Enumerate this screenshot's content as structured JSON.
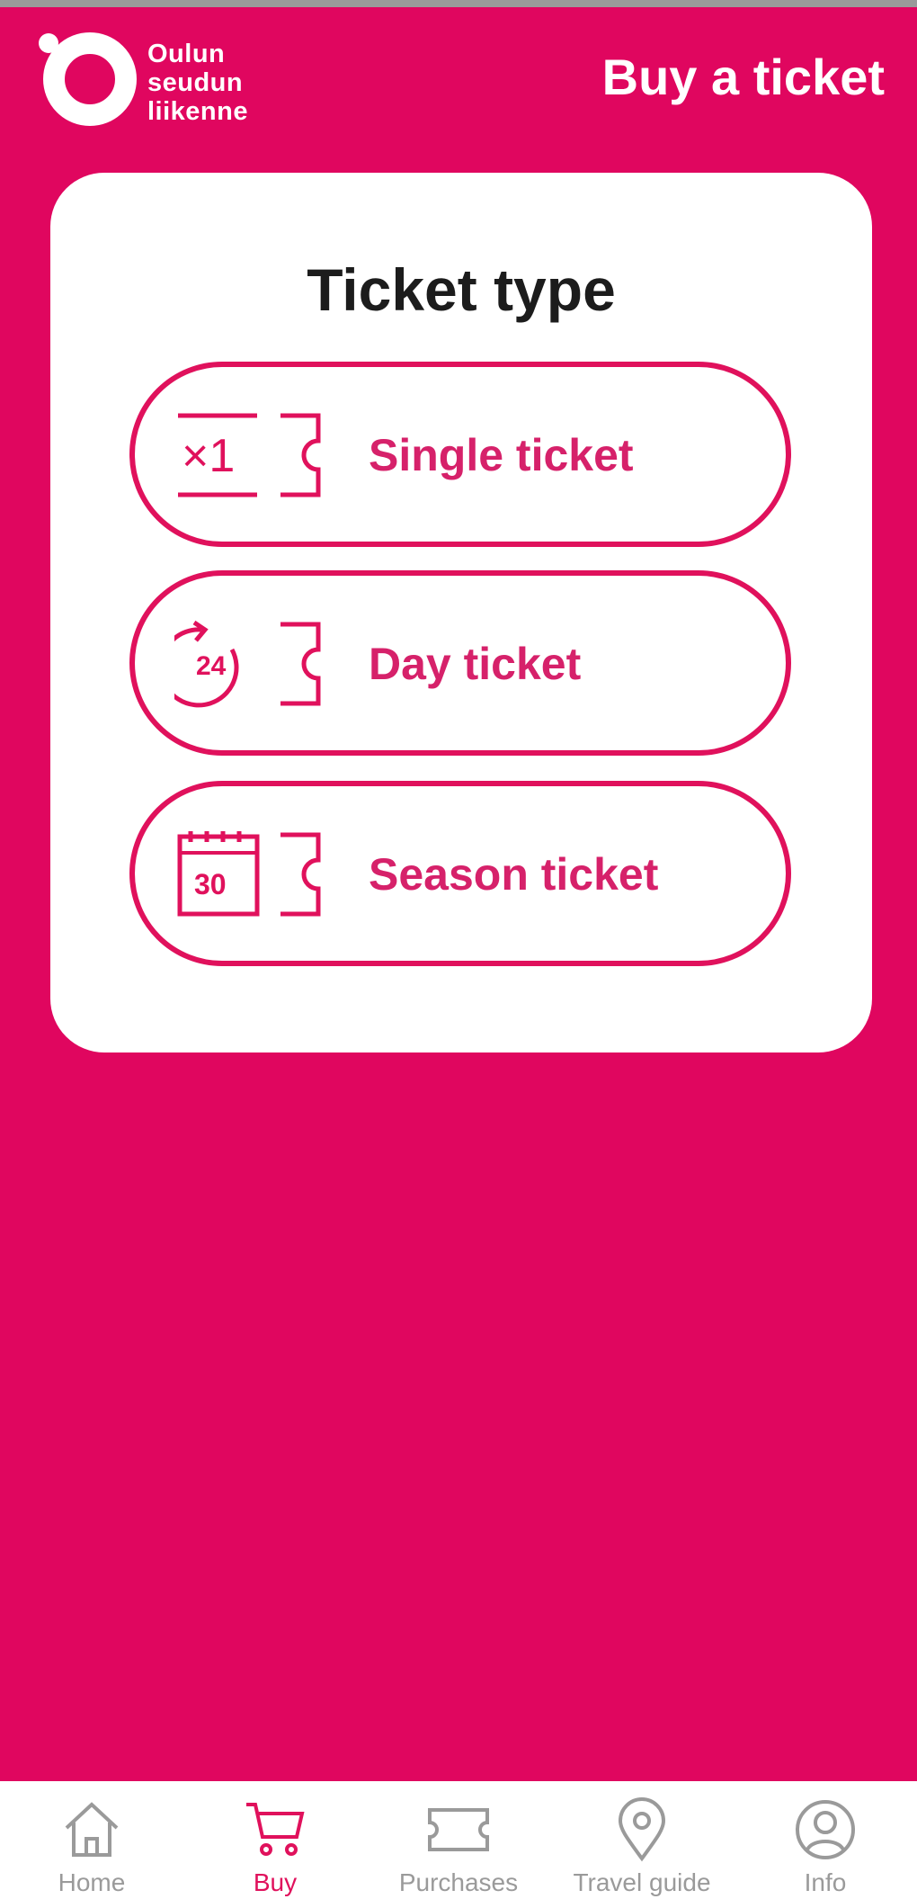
{
  "header": {
    "logo_lines": [
      "Oulun",
      "seudun",
      "liikenne"
    ],
    "title": "Buy a ticket"
  },
  "card": {
    "title": "Ticket type",
    "options": [
      {
        "label": "Single ticket",
        "icon": "single-ticket-icon",
        "icon_text": "×1"
      },
      {
        "label": "Day ticket",
        "icon": "day-ticket-icon",
        "icon_text": "24"
      },
      {
        "label": "Season ticket",
        "icon": "season-ticket-icon",
        "icon_text": "30"
      }
    ]
  },
  "nav": {
    "items": [
      {
        "label": "Home",
        "icon": "home-icon",
        "active": false
      },
      {
        "label": "Buy",
        "icon": "cart-icon",
        "active": true
      },
      {
        "label": "Purchases",
        "icon": "ticket-icon",
        "active": false
      },
      {
        "label": "Travel guide",
        "icon": "map-pin-icon",
        "active": false
      },
      {
        "label": "Info",
        "icon": "user-icon",
        "active": false
      }
    ]
  },
  "colors": {
    "brand": "#e0065f",
    "accent": "#e0115c",
    "label": "#d6216a",
    "inactive": "#9a9a9a"
  }
}
